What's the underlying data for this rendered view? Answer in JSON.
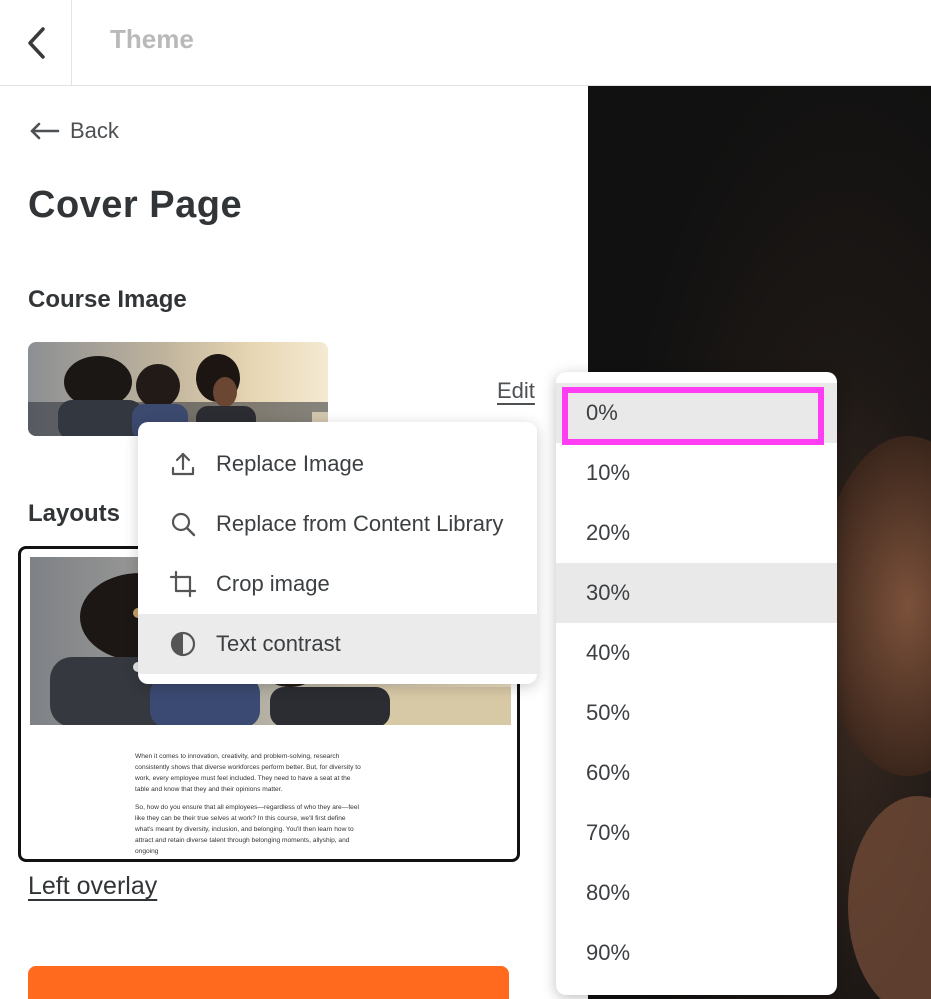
{
  "header": {
    "title": "Theme"
  },
  "panel": {
    "back_label": "Back",
    "page_title": "Cover Page",
    "course_image_label": "Course Image",
    "edit_label": "Edit",
    "layouts_label": "Layouts",
    "layout_name": "Left overlay",
    "layout_preview_paragraphs": [
      "When it comes to innovation, creativity, and problem-solving, research consistently shows that diverse workforces perform better. But, for diversity to work, every employee must feel included. They need to have a seat at the table and know that they and their opinions matter.",
      "So, how do you ensure that all employees—regardless of who they are—feel like they can be their true selves at work? In this course, we'll first define what's meant by diversity, inclusion, and belonging. You'll then learn how to attract and retain diverse talent through belonging moments, allyship, and ongoing"
    ]
  },
  "context_menu": {
    "items": [
      {
        "label": "Replace Image",
        "icon": "upload-icon"
      },
      {
        "label": "Replace from Content Library",
        "icon": "search-icon"
      },
      {
        "label": "Crop image",
        "icon": "crop-icon"
      },
      {
        "label": "Text contrast",
        "icon": "contrast-icon"
      }
    ],
    "active_item": "Text contrast"
  },
  "contrast_dropdown": {
    "options": [
      "0%",
      "10%",
      "20%",
      "30%",
      "40%",
      "50%",
      "60%",
      "70%",
      "80%",
      "90%"
    ],
    "selected": "0%",
    "hovered": "30%"
  },
  "colors": {
    "accent": "#ff6a1f",
    "highlight": "#ff3df2",
    "text": "#313537",
    "muted": "#b9b9b9"
  }
}
